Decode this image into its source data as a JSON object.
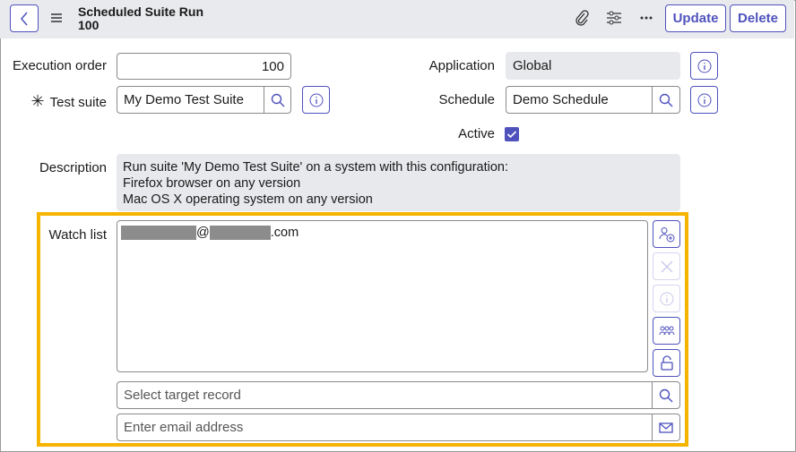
{
  "header": {
    "title": "Scheduled Suite Run",
    "subtitle": "100",
    "update_label": "Update",
    "delete_label": "Delete",
    "icons": [
      "chevron-left-icon",
      "menu-icon",
      "paperclip-icon",
      "sliders-icon",
      "more-icon"
    ]
  },
  "form": {
    "execution_order": {
      "label": "Execution order",
      "value": "100"
    },
    "test_suite": {
      "label": "Test suite",
      "value": "My Demo Test Suite",
      "required": true
    },
    "application": {
      "label": "Application",
      "value": "Global"
    },
    "schedule": {
      "label": "Schedule",
      "value": "Demo Schedule"
    },
    "active": {
      "label": "Active",
      "checked": true
    },
    "description": {
      "label": "Description",
      "lines": [
        "Run suite 'My Demo Test Suite' on a system with this configuration:",
        "Firefox browser on any version",
        "Mac OS X operating system on any version"
      ]
    },
    "watch_list": {
      "label": "Watch list",
      "at": "@",
      "domain": ".com",
      "target_placeholder": "Select target record",
      "email_placeholder": "Enter email address"
    }
  },
  "colors": {
    "accent": "#4f52bd",
    "highlight": "#f5b400",
    "header_bg": "#e9eaee"
  }
}
